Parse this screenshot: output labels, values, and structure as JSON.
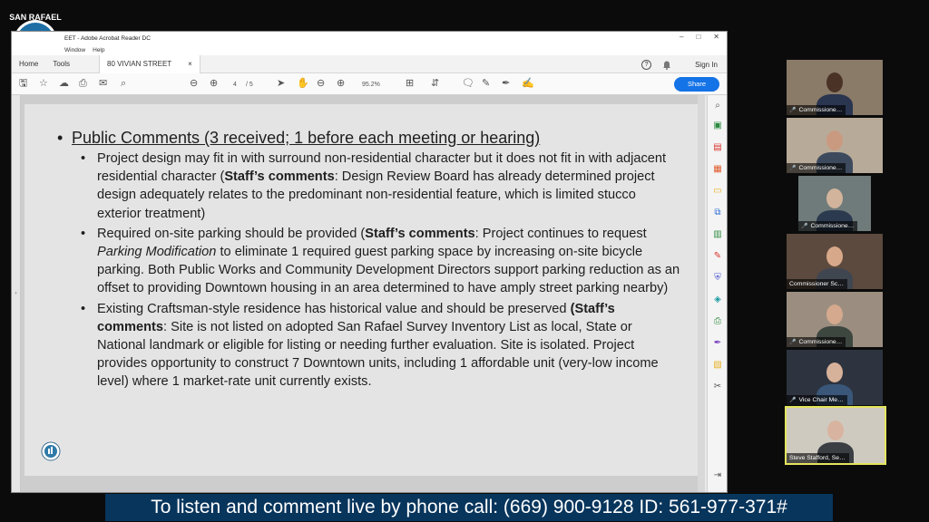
{
  "brand": {
    "top_text": "SAN RAFAEL"
  },
  "acrobat": {
    "title": "EET - Adobe Acrobat Reader DC",
    "menu": [
      "Window",
      "Help"
    ],
    "tabs": {
      "home": "Home",
      "tools": "Tools",
      "document": "80 VIVIAN STREET",
      "close": "×"
    },
    "help_icon": "?",
    "bell_icon": "bell-icon",
    "sign_in": "Sign In",
    "page_current": "4",
    "page_total": "/ 5",
    "zoom": "95.2%",
    "share": "Share",
    "window_controls": [
      "–",
      "□",
      "✕"
    ]
  },
  "slide": {
    "title": "Public Comments (3  received; 1 before each meeting or hearing)",
    "bullets": [
      {
        "pre": "Project design may fit in with surround non-residential character but it does not fit in with adjacent residential character (",
        "bold": "Staff’s comments",
        "post": ": Design Review Board has already determined project design adequately relates to the predominant non-residential feature, which is limited stucco exterior treatment)"
      },
      {
        "pre": "Required on-site parking should be provided (",
        "bold": "Staff’s comments",
        "mid": ": Project continues to request ",
        "italic": "Parking Modification",
        "post": " to eliminate 1 required guest parking space by increasing on-site bicycle parking. Both Public Works and Community Development Directors support parking reduction as an offset to providing Downtown housing in an area determined to have amply street parking nearby)"
      },
      {
        "pre": "Existing Craftsman-style residence has historical value and should be preserved ",
        "bold": "(Staff’s comments",
        "post": ": Site is not listed on adopted San Rafael Survey Inventory List as local, State or National landmark or eligible for listing or needing further evaluation. Site is isolated. Project provides opportunity to construct 7 Downtown units, including 1 affordable unit (very-low income level) where 1 market-rate unit currently exists."
      }
    ]
  },
  "participants": [
    {
      "name": "Commissione…",
      "bg": "#8a7a68",
      "skin": "#4a3326",
      "shirt": "#2a3550",
      "muted": true
    },
    {
      "name": "Commissione…",
      "bg": "#b8aa98",
      "skin": "#c99a80",
      "shirt": "#3d4a5e",
      "muted": true
    },
    {
      "name": "Commissione…",
      "bg": "#6f7a7a",
      "skin": "#d2b49c",
      "shirt": "#2b3a4e",
      "muted": true
    },
    {
      "name": "Commissioner Sc…",
      "bg": "#5c4a3e",
      "skin": "#d8a88a",
      "shirt": "#404650",
      "muted": false
    },
    {
      "name": "Commissione…",
      "bg": "#9b8e80",
      "skin": "#d4a98d",
      "shirt": "#3e4640",
      "muted": true
    },
    {
      "name": "Vice Chair Me…",
      "bg": "#2d3440",
      "skin": "#d7b29a",
      "shirt": "#3a5678",
      "muted": true
    },
    {
      "name": "Steve Stafford, Se…",
      "bg": "#cfcac0",
      "skin": "#d8b4a0",
      "shirt": "#3b3f44",
      "muted": false
    }
  ],
  "caption": "To listen and comment live by phone call: (669) 900-9128 ID: 561-977-371#"
}
